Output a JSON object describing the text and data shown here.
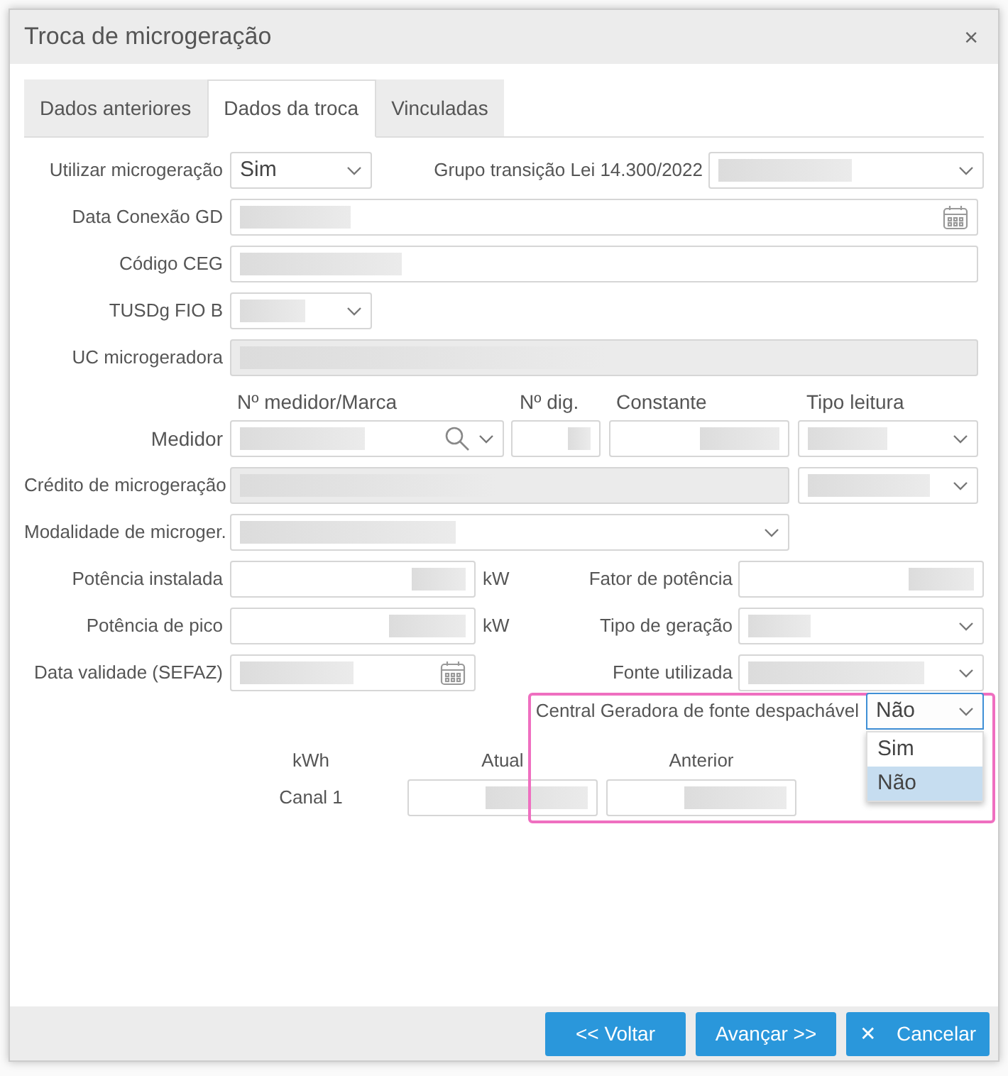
{
  "dialog": {
    "title": "Troca de microgeração",
    "close": "×"
  },
  "tabs": [
    {
      "label": "Dados anteriores",
      "selected": false
    },
    {
      "label": "Dados da troca",
      "selected": true
    },
    {
      "label": "Vinculadas",
      "selected": false
    }
  ],
  "utilizar_microgeracao": {
    "label": "Utilizar microgeração",
    "kind": "select",
    "value": "Sim"
  },
  "grupo_transicao": {
    "label": "Grupo transição Lei 14.300/2022",
    "kind": "select",
    "redacted": true
  },
  "data_conexao_gd": {
    "label": "Data Conexão GD",
    "kind": "date",
    "redacted": true
  },
  "codigo_ceg": {
    "label": "Código CEG",
    "kind": "text",
    "redacted": true
  },
  "tusdg_fio_b": {
    "label": "TUSDg FIO B",
    "kind": "select",
    "redacted": true
  },
  "uc_microgeradora": {
    "label": "UC microgeradora",
    "kind": "text",
    "disabled": true,
    "redacted": true
  },
  "medidor": {
    "label": "Medidor",
    "columns": [
      "Nº medidor/Marca",
      "Nº dig.",
      "Constante",
      "Tipo leitura"
    ],
    "fields": [
      {
        "kind": "lookup",
        "redacted": true
      },
      {
        "kind": "number",
        "redacted": true
      },
      {
        "kind": "number",
        "redacted": true
      },
      {
        "kind": "select",
        "redacted": true
      }
    ]
  },
  "credito": {
    "label": "Crédito de microgeração",
    "fields": [
      {
        "kind": "text",
        "disabled": true,
        "redacted": true
      },
      {
        "kind": "select",
        "redacted": true
      }
    ]
  },
  "modalidade": {
    "label": "Modalidade de microger.",
    "kind": "select",
    "redacted": true
  },
  "potencia_instalada": {
    "label": "Potência instalada",
    "kind": "number",
    "unit": "kW",
    "redacted": true
  },
  "fator_potencia": {
    "label": "Fator de potência",
    "kind": "number",
    "redacted": true
  },
  "potencia_pico": {
    "label": "Potência de pico",
    "kind": "number",
    "unit": "kW",
    "redacted": true
  },
  "tipo_geracao": {
    "label": "Tipo de geração",
    "kind": "select",
    "redacted": true
  },
  "data_validade": {
    "label": "Data validade (SEFAZ)",
    "kind": "date",
    "redacted": true
  },
  "fonte_utilizada": {
    "label": "Fonte utilizada",
    "kind": "select",
    "redacted": true
  },
  "central_geradora": {
    "label": "Central Geradora de fonte despachável",
    "kind": "select",
    "value": "Não",
    "focused": true,
    "highlighted": true,
    "expanded": true,
    "options": [
      {
        "label": "Sim",
        "selected": false
      },
      {
        "label": "Não",
        "selected": true
      }
    ]
  },
  "leituras": {
    "unit": "kWh",
    "columns": [
      "Atual",
      "Anterior"
    ],
    "rows": [
      {
        "label": "Canal 1",
        "fields": [
          {
            "kind": "number",
            "redacted": true
          },
          {
            "kind": "number",
            "redacted": true
          }
        ]
      }
    ]
  },
  "buttons": [
    {
      "label": "<< Voltar",
      "kind": "back"
    },
    {
      "label": "Avançar >>",
      "kind": "next"
    },
    {
      "label": "Cancelar",
      "kind": "cancel",
      "icon": "✕"
    }
  ]
}
